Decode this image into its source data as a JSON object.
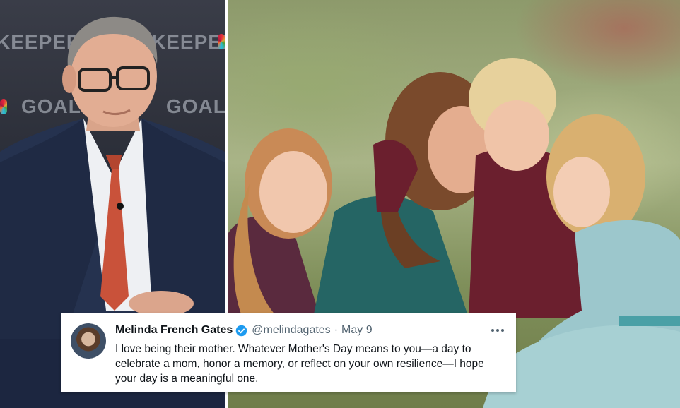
{
  "left_photo": {
    "backdrop_words": [
      "KEEPERS",
      "KEEPERS",
      "GOALKEE",
      "GOALKEEPERS"
    ]
  },
  "tweet": {
    "display_name": "Melinda French Gates",
    "verified_icon": "verified-badge-icon",
    "handle": "@melindagates",
    "separator": "·",
    "date": "May 9",
    "more_icon": "more-horizontal-icon",
    "more_label": "•••",
    "text": "I love being their mother. Whatever Mother's Day means to you—a day to celebrate a mom, honor a memory, or reflect on your own resilience—I hope your day is a meaningful one.",
    "colors": {
      "text": "#0f1419",
      "secondary": "#536471",
      "verified": "#1d9bf0"
    }
  }
}
